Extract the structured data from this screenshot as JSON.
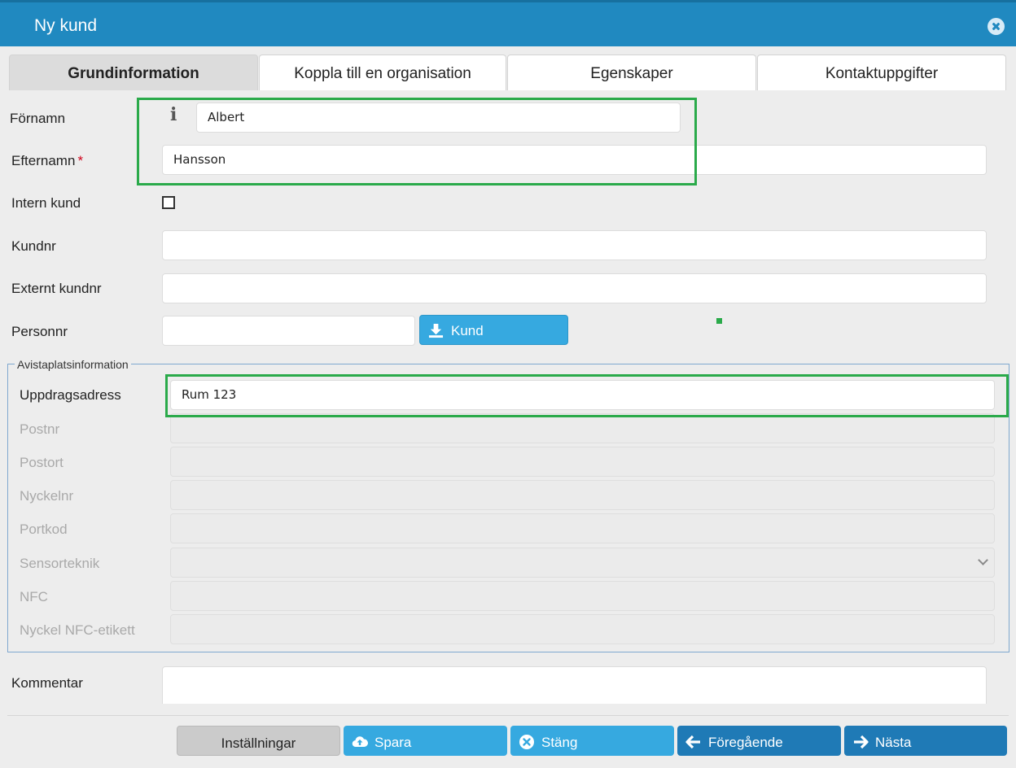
{
  "window": {
    "title": "Ny kund"
  },
  "tabs": [
    {
      "label": "Grundinformation",
      "active": true
    },
    {
      "label": "Koppla till en organisation",
      "active": false
    },
    {
      "label": "Egenskaper",
      "active": false
    },
    {
      "label": "Kontaktuppgifter",
      "active": false
    }
  ],
  "fields": {
    "fornamn": {
      "label": "Förnamn",
      "value": "Albert",
      "info_icon": "info-icon"
    },
    "efternamn": {
      "label": "Efternamn",
      "required_mark": "*",
      "value": "Hansson"
    },
    "intern_kund": {
      "label": "Intern kund",
      "checked": false
    },
    "kundnr": {
      "label": "Kundnr",
      "value": ""
    },
    "externt_kundnr": {
      "label": "Externt kundnr",
      "value": ""
    },
    "personnr": {
      "label": "Personnr",
      "value": "",
      "button_label": "Kund",
      "button_icon": "download-icon"
    }
  },
  "avistaplats": {
    "legend": "Avistaplatsinformation",
    "uppdragsadress": {
      "label": "Uppdragsadress",
      "value": "Rum 123"
    },
    "postnr": {
      "label": "Postnr",
      "value": ""
    },
    "postort": {
      "label": "Postort",
      "value": ""
    },
    "nyckelnr": {
      "label": "Nyckelnr",
      "value": ""
    },
    "portkod": {
      "label": "Portkod",
      "value": ""
    },
    "sensorteknik": {
      "label": "Sensorteknik",
      "value": ""
    },
    "nfc": {
      "label": "NFC",
      "value": ""
    },
    "nyckel_nfc": {
      "label": "Nyckel NFC-etikett",
      "value": ""
    }
  },
  "kommentar": {
    "label": "Kommentar",
    "value": ""
  },
  "footer": {
    "installningar": "Inställningar",
    "spara": "Spara",
    "stang": "Stäng",
    "foregaende": "Föregående",
    "nasta": "Nästa"
  },
  "colors": {
    "titlebar": "#2089c0",
    "button_light": "#36a9e0",
    "button_dark": "#1f7ab6",
    "highlight": "#2aaa4a",
    "required": "#d0021b"
  }
}
